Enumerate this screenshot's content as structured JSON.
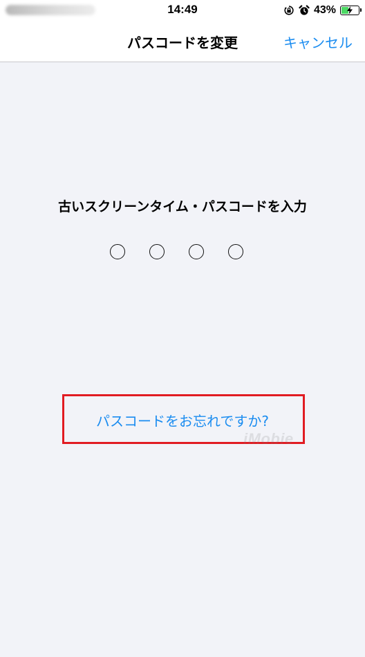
{
  "status_bar": {
    "time": "14:49",
    "battery_percent": "43%",
    "battery_level": 0.43,
    "icons": [
      "orientation-lock-icon",
      "alarm-icon",
      "battery-charging-icon"
    ]
  },
  "nav": {
    "title": "パスコードを変更",
    "cancel_label": "キャンセル"
  },
  "main": {
    "prompt": "古いスクリーンタイム・パスコードを入力",
    "passcode_length": 4,
    "forgot_link": "パスコードをお忘れですか?"
  },
  "watermark": "iMobie",
  "colors": {
    "accent": "#1a8cf0",
    "highlight": "#e11b22",
    "background": "#f2f3f8",
    "battery": "#4cd964"
  }
}
